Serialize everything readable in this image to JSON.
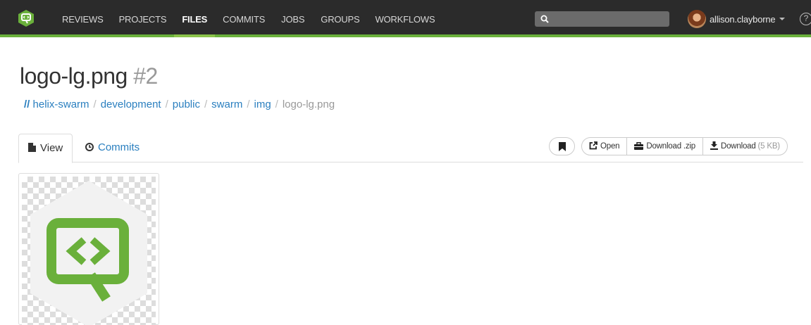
{
  "nav": {
    "items": [
      "REVIEWS",
      "PROJECTS",
      "FILES",
      "COMMITS",
      "JOBS",
      "GROUPS",
      "WORKFLOWS"
    ],
    "active": "FILES",
    "accent": "#6ab03b"
  },
  "search": {
    "placeholder": ""
  },
  "user": {
    "name": "allison.clayborne",
    "help": "?"
  },
  "page": {
    "filename": "logo-lg.png",
    "revision": "#2"
  },
  "breadcrumb": {
    "root": "//",
    "parts": [
      "helix-swarm",
      "development",
      "public",
      "swarm",
      "img"
    ],
    "current": "logo-lg.png"
  },
  "tabs": {
    "view": "View",
    "commits": "Commits"
  },
  "toolbar": {
    "open": "Open",
    "download_zip": "Download .zip",
    "download": "Download",
    "download_size": "(5 KB)"
  },
  "icons": {
    "logo": "swarm-logo-icon",
    "search": "search-icon",
    "bookmark": "bookmark-icon",
    "open": "external-link-icon",
    "zip": "briefcase-icon",
    "download": "download-icon",
    "view": "file-icon",
    "commits": "clock-icon"
  }
}
